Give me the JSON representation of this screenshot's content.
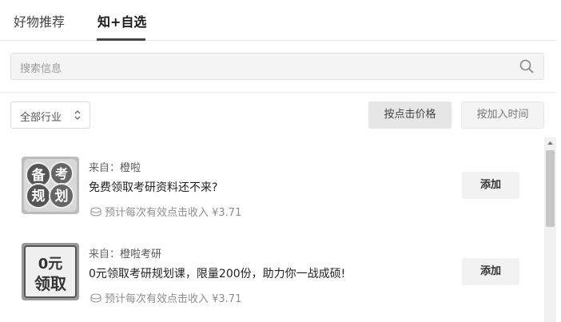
{
  "tabs": [
    {
      "label": "好物推荐",
      "active": false
    },
    {
      "label": "知+自选",
      "active": true
    }
  ],
  "search": {
    "placeholder": "搜索信息"
  },
  "filter": {
    "industry_label": "全部行业"
  },
  "sort": {
    "by_price": "按点击价格",
    "by_time": "按加入时间"
  },
  "items": [
    {
      "thumb_text": [
        "备",
        "考",
        "规",
        "划"
      ],
      "source_label": "来自：",
      "source": "橙啦",
      "title": "免费领取考研资料还不来?",
      "income": "预计每次有效点击收入 ¥3.71",
      "add_label": "添加"
    },
    {
      "thumb_text": [
        "0元",
        "领取"
      ],
      "source_label": "来自：",
      "source": "橙啦考研",
      "title": "0元领取考研规划课，限量200份，助力你一战成硕!",
      "income": "预计每次有效点击收入 ¥3.71",
      "add_label": "添加"
    }
  ],
  "colors": {
    "accent": "#444444",
    "muted": "#8e8e8e",
    "button_bg": "#f2f2f2"
  }
}
